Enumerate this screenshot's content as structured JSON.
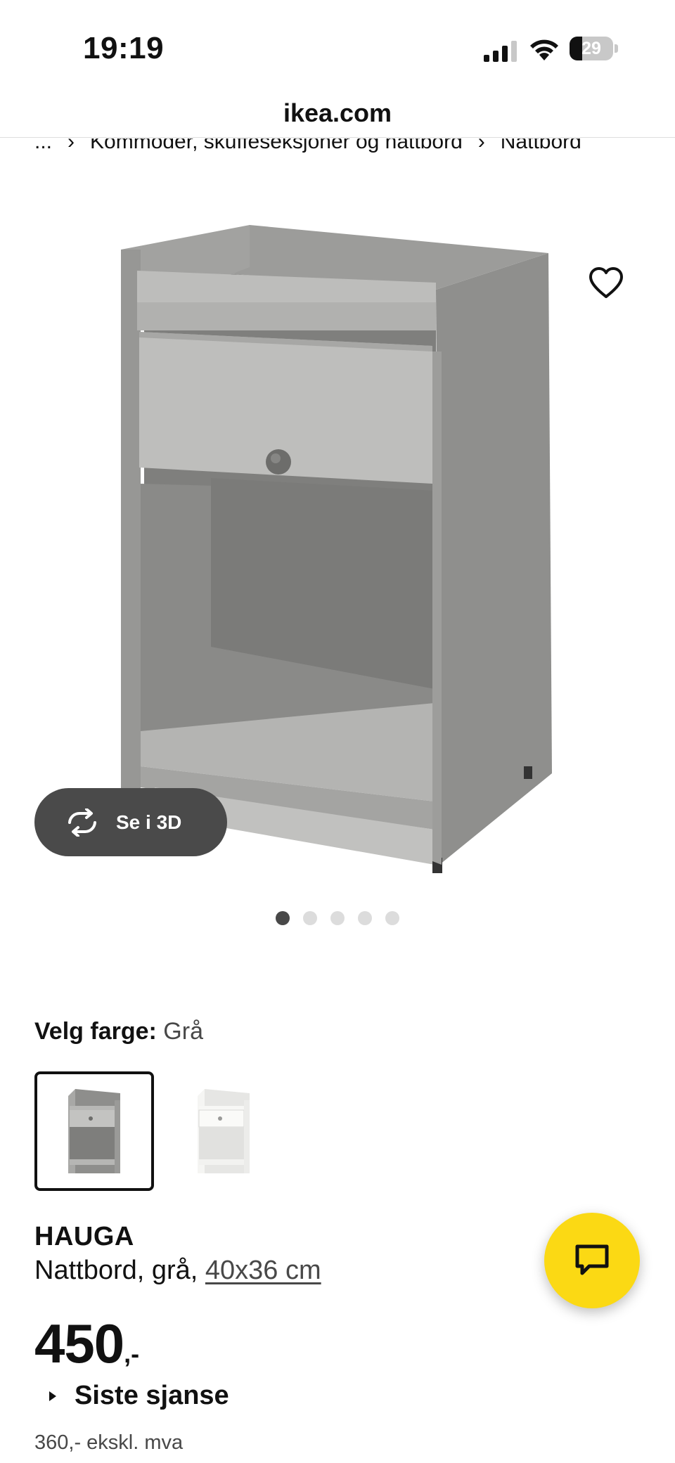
{
  "status_bar": {
    "time": "19:19",
    "battery_percent": "29",
    "battery_level": 0.29
  },
  "browser": {
    "url": "ikea.com"
  },
  "breadcrumb": {
    "items": [
      "...",
      "Kommoder, skuffeseksjoner og nattbord",
      "Nattbord"
    ],
    "separator": "›"
  },
  "gallery": {
    "view_3d_label": "Se i 3D",
    "image_count": 5,
    "active_index": 0
  },
  "color": {
    "label": "Velg farge:",
    "selected_value": "Grå",
    "options": [
      {
        "name": "grå",
        "hex": "#a5a5a3",
        "selected": true
      },
      {
        "name": "hvit",
        "hex": "#f2f2f0",
        "selected": false
      }
    ]
  },
  "product": {
    "name": "HAUGA",
    "description": "Nattbord, grå, ",
    "size_link": "40x36 cm",
    "price_main": "450",
    "price_suffix": ",-",
    "last_chance": "Siste sjanse",
    "price_excl_vat": "360,- ekskl. mva"
  },
  "icons": {
    "favorite": "heart-icon",
    "rotate": "rotate-3d-icon",
    "chat": "chat-bubble-icon"
  },
  "colors": {
    "accent_yellow": "#fbd914",
    "dark_pill": "#4a4a4a",
    "text_primary": "#111111",
    "text_secondary": "#484848"
  }
}
